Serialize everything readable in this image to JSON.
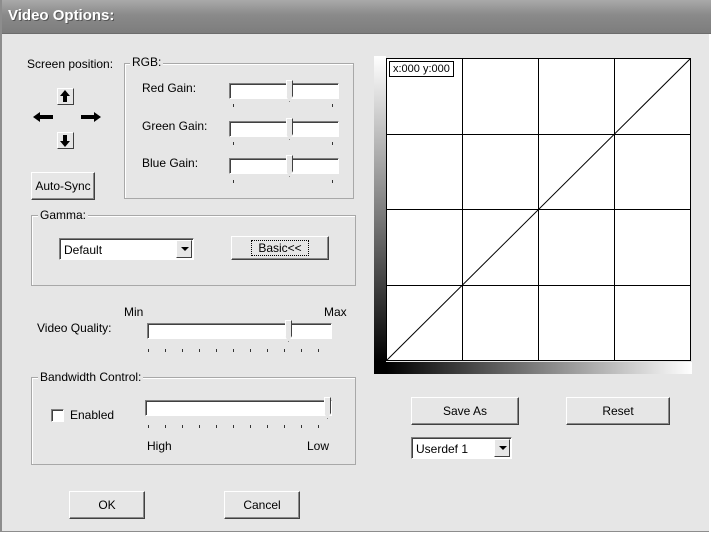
{
  "window": {
    "title": "Video Options:"
  },
  "screen_position": {
    "label": "Screen position:",
    "up_icon": "arrow-up-icon",
    "down_icon": "arrow-down-icon",
    "left_icon": "arrow-left-icon",
    "right_icon": "arrow-right-icon",
    "autosync_label": "Auto-Sync"
  },
  "rgb": {
    "legend": "RGB:",
    "sliders": [
      {
        "label": "Red Gain:",
        "value": 0.55
      },
      {
        "label": "Green Gain:",
        "value": 0.55
      },
      {
        "label": "Blue Gain:",
        "value": 0.55
      }
    ]
  },
  "gamma": {
    "legend": "Gamma:",
    "selected": "Default",
    "basic_label": "Basic<<"
  },
  "video_quality": {
    "label": "Video Quality:",
    "min_label": "Min",
    "max_label": "Max",
    "value": 0.78
  },
  "bandwidth": {
    "legend": "Bandwidth Control:",
    "enabled_label": "Enabled",
    "enabled": false,
    "high_label": "High",
    "low_label": "Low",
    "value": 1.0
  },
  "curve": {
    "coordinate_readout": "x:000 y:000"
  },
  "buttons": {
    "save_as": "Save As",
    "reset": "Reset",
    "ok": "OK",
    "cancel": "Cancel"
  },
  "profile": {
    "selected": "Userdef 1"
  }
}
